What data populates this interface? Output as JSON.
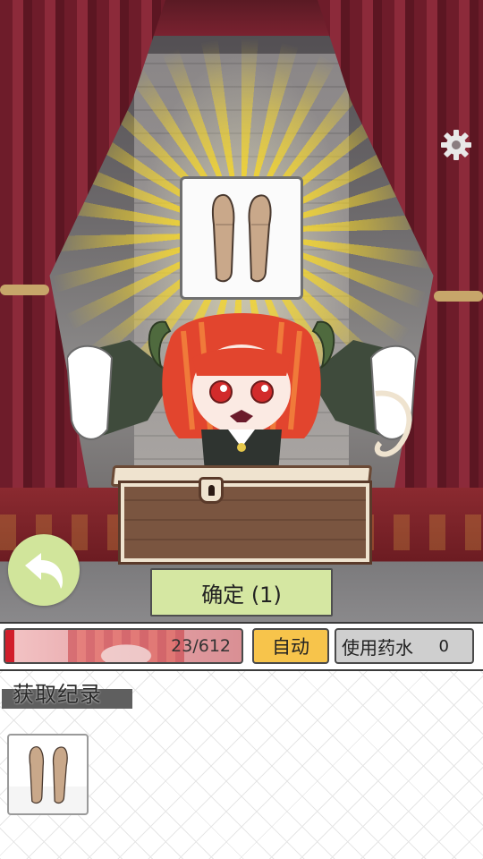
{
  "scene": {
    "item_icon": "leg-accessory-icon",
    "settings_icon": "gear-icon"
  },
  "controls": {
    "back_icon": "back-arrow-icon",
    "confirm_label": "确定 (1)",
    "hp_text": "23/612",
    "hp_fraction": 0.0376,
    "auto_label": "自动",
    "potion_label": "使用药水",
    "potion_count": "0"
  },
  "records": {
    "title": "获取纪录",
    "items": [
      {
        "icon": "leg-accessory-icon"
      }
    ]
  },
  "colors": {
    "accent_green": "#d5e7a2",
    "auto_yellow": "#f7c44b",
    "hp_red": "#d11e2b"
  }
}
